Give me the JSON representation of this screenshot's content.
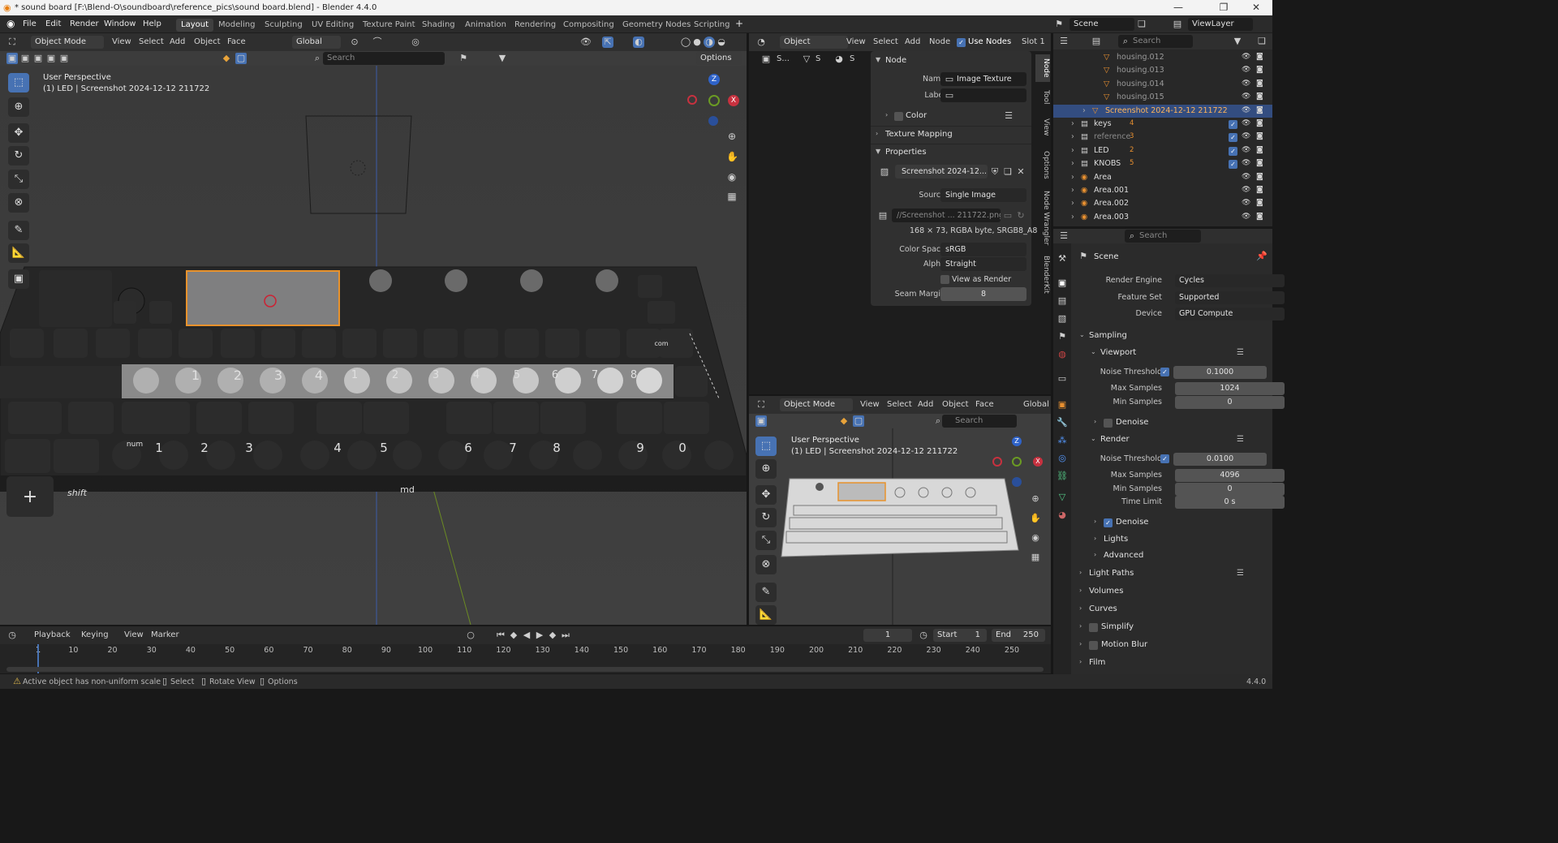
{
  "window": {
    "title": "* sound board [F:\\Blend-O\\soundboard\\reference_pics\\sound board.blend] - Blender 4.4.0"
  },
  "menu": [
    "File",
    "Edit",
    "Render",
    "Window",
    "Help"
  ],
  "workspaces": [
    "Layout",
    "Modeling",
    "Sculpting",
    "UV Editing",
    "Texture Paint",
    "Shading",
    "Animation",
    "Rendering",
    "Compositing",
    "Geometry Nodes",
    "Scripting"
  ],
  "topright": {
    "scene": "Scene",
    "viewlayer": "ViewLayer"
  },
  "viewport": {
    "mode": "Object Mode",
    "menus": [
      "View",
      "Select",
      "Add",
      "Object",
      "Face"
    ],
    "orientation": "Global",
    "search_placeholder": "Search",
    "options": "Options",
    "overlay_line1": "User Perspective",
    "overlay_line2": "(1) LED | Screenshot 2024-12-12 211722",
    "gizmo": {
      "z": "Z",
      "x": "X",
      "y": "Y"
    },
    "key_labels": [
      "1",
      "2",
      "3",
      "4",
      "1",
      "2",
      "3",
      "4",
      "5",
      "6",
      "7",
      "8",
      "num",
      "1",
      "2",
      "3",
      "4",
      "5",
      "6",
      "7",
      "8",
      "9",
      "0",
      "shift",
      "md",
      "com"
    ]
  },
  "node_editor": {
    "type": "Object",
    "menus": [
      "View",
      "Select",
      "Add",
      "Node"
    ],
    "use_nodes": "Use Nodes",
    "slot": "Slot 1",
    "breadcrumb": [
      "S...",
      "S",
      "S"
    ],
    "panel": {
      "section_node": "Node",
      "name_label": "Name",
      "name_value": "Image Texture",
      "label_label": "Label",
      "label_value": "",
      "color": "Color",
      "texture_mapping": "Texture Mapping",
      "properties": "Properties",
      "image_name": "Screenshot 2024-12...",
      "source_label": "Source",
      "source_value": "Single Image",
      "filepath": "//Screenshot ... 211722.png",
      "info": "168 × 73,  RGBA byte, SRGB8_A8",
      "colorspace_label": "Color Space",
      "colorspace_value": "sRGB",
      "alpha_label": "Alpha",
      "alpha_value": "Straight",
      "view_as_render": "View as Render",
      "seam_label": "Seam Margin",
      "seam_value": "8"
    },
    "tabs": [
      "Node",
      "Tool",
      "View",
      "Options",
      "Node Wrangler",
      "BlenderKit"
    ]
  },
  "viewport2": {
    "mode": "Object Mode",
    "menus": [
      "View",
      "Select",
      "Add",
      "Object",
      "Face"
    ],
    "orientation": "Global",
    "search_placeholder": "Search",
    "overlay_line1": "User Perspective",
    "overlay_line2": "(1) LED | Screenshot 2024-12-12 211722"
  },
  "outliner": {
    "search_placeholder": "Search",
    "rows": [
      {
        "name": "housing.012",
        "indent": 3
      },
      {
        "name": "housing.013",
        "indent": 3
      },
      {
        "name": "housing.014",
        "indent": 3
      },
      {
        "name": "housing.015",
        "indent": 3
      },
      {
        "name": "Screenshot 2024-12-12 211722",
        "indent": 2,
        "selected": true
      },
      {
        "name": "keys",
        "indent": 1,
        "badge": "4"
      },
      {
        "name": "reference",
        "indent": 1,
        "badge": "3"
      },
      {
        "name": "LED",
        "indent": 1,
        "badge": "2"
      },
      {
        "name": "KNOBS",
        "indent": 1,
        "badge": "5"
      },
      {
        "name": "Area",
        "indent": 1
      },
      {
        "name": "Area.001",
        "indent": 1
      },
      {
        "name": "Area.002",
        "indent": 1
      },
      {
        "name": "Area.003",
        "indent": 1
      }
    ]
  },
  "properties": {
    "search_placeholder": "Search",
    "context": "Scene",
    "render_engine_label": "Render Engine",
    "render_engine": "Cycles",
    "feature_set_label": "Feature Set",
    "feature_set": "Supported",
    "device_label": "Device",
    "device": "GPU Compute",
    "sampling": "Sampling",
    "viewport": "Viewport",
    "noise_threshold_label": "Noise Threshold",
    "vp_noise": "0.1000",
    "max_samples_label": "Max Samples",
    "vp_max": "1024",
    "min_samples_label": "Min Samples",
    "vp_min": "0",
    "denoise": "Denoise",
    "render": "Render",
    "r_noise": "0.0100",
    "r_max": "4096",
    "r_min": "0",
    "time_limit_label": "Time Limit",
    "r_time": "0 s",
    "lights": "Lights",
    "advanced": "Advanced",
    "light_paths": "Light Paths",
    "volumes": "Volumes",
    "curves": "Curves",
    "simplify": "Simplify",
    "motion_blur": "Motion Blur",
    "film": "Film"
  },
  "timeline": {
    "menus": [
      "Playback",
      "Keying",
      "View",
      "Marker"
    ],
    "current": "1",
    "start_label": "Start",
    "start": "1",
    "end_label": "End",
    "end": "250",
    "ticks": [
      "1",
      "10",
      "20",
      "30",
      "40",
      "50",
      "60",
      "70",
      "80",
      "90",
      "100",
      "110",
      "120",
      "130",
      "140",
      "150",
      "160",
      "170",
      "180",
      "190",
      "200",
      "210",
      "220",
      "230",
      "240",
      "250"
    ]
  },
  "status": {
    "warning": "Active object has non-uniform scale",
    "select": "Select",
    "rotate": "Rotate View",
    "options": "Options",
    "version": "4.4.0"
  }
}
